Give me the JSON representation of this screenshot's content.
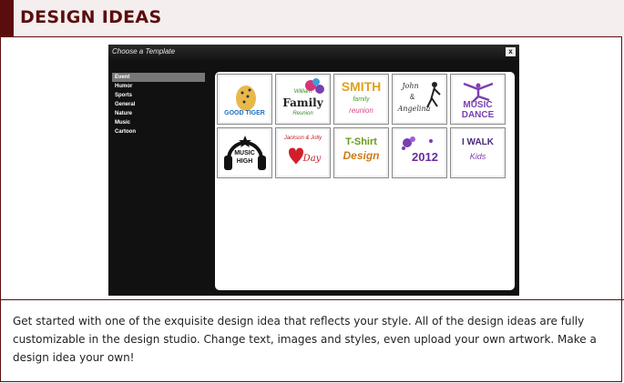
{
  "header": {
    "title": "DESIGN IDEAS"
  },
  "dialog": {
    "title": "Choose a Template",
    "close_label": "x",
    "categories": [
      "Event",
      "Humor",
      "Sports",
      "General",
      "Nature",
      "Music",
      "Cartoon"
    ],
    "active_category": "Event",
    "templates": [
      {
        "name": "cheetah",
        "lines": [
          "GOOD TIGER"
        ]
      },
      {
        "name": "family-reunion",
        "lines": [
          "William",
          "Family",
          "Reunion"
        ]
      },
      {
        "name": "smith-family-reunion",
        "lines": [
          "SMITH",
          "family",
          "reunion"
        ]
      },
      {
        "name": "john-angelina",
        "lines": [
          "John",
          "&",
          "Angelina"
        ]
      },
      {
        "name": "music-dance",
        "lines": [
          "MUSIC",
          "DANCE"
        ]
      },
      {
        "name": "music-high",
        "lines": [
          "MUSIC",
          "HIGH"
        ]
      },
      {
        "name": "valentine-day",
        "lines": [
          "Jackson & Jolly",
          "Day"
        ]
      },
      {
        "name": "tshirt-design",
        "lines": [
          "T-Shirt",
          "Design"
        ]
      },
      {
        "name": "2012",
        "lines": [
          "2012"
        ]
      },
      {
        "name": "i-walk-kids",
        "lines": [
          "I WALK",
          "Kids"
        ]
      }
    ]
  },
  "description": "Get started with one of the exquisite design idea that reflects your style. All of the design ideas are fully customizable in the design studio. Change text, images and styles, even upload your own artwork. Make a design idea your own!"
}
